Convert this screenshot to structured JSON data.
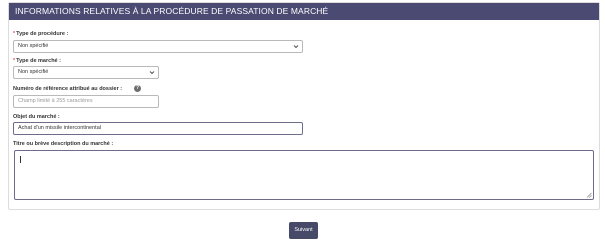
{
  "section": {
    "title": "INFORMATIONS RELATIVES À LA PROCÉDURE DE PASSATION DE MARCHÉ"
  },
  "form": {
    "procedure_type": {
      "required_mark": "*",
      "label": "Type de procédure :",
      "value": "Non spécifié",
      "icon": "chevron-down-icon"
    },
    "market_type": {
      "required_mark": "*",
      "label": "Type de marché :",
      "value": "Non spécifié",
      "icon": "chevron-down-icon"
    },
    "reference_number": {
      "label": "Numéro de référence attribué au dossier :",
      "placeholder": "Champ limité à 255 caractères",
      "help_icon": "question-circle-icon",
      "help_glyph": "?"
    },
    "market_object": {
      "label": "Objet du marché :",
      "value": "Achat d'un missile intercontinental"
    },
    "market_title": {
      "label": "Titre ou brève description du marché :",
      "value": ""
    }
  },
  "actions": {
    "next_label": "Suivant"
  },
  "colors": {
    "header_bg": "#4a4a72",
    "button_bg": "#464968",
    "required": "#d9534f"
  }
}
